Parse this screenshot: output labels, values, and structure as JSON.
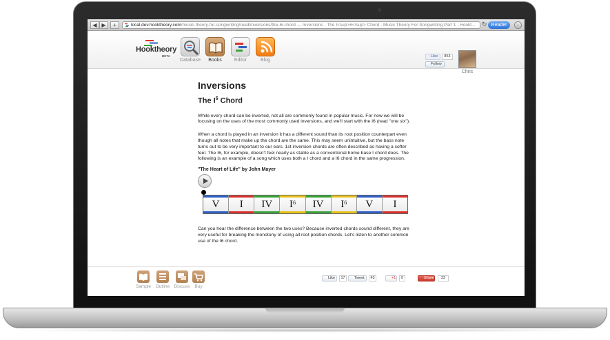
{
  "browser": {
    "url_host": "local.dev.hooktheory.com",
    "url_rest": "/music-theory-for-songwriting/read/inversions/the-i6-chord — Inversions - The I<sup>6</sup> Chord - Music Theory For Songwriting Part 1 - Hookt...",
    "reader_label": "Reader",
    "back_glyph": "◀",
    "forward_glyph": "▶",
    "new_tab_glyph": "+",
    "reload_glyph": "↻",
    "download_glyph": "↓"
  },
  "header": {
    "logo_text": "Hooktheory",
    "logo_sub": "BETA",
    "nav": [
      {
        "label": "Database",
        "icon": "magnifier-icon"
      },
      {
        "label": "Books",
        "icon": "book-icon"
      },
      {
        "label": "Editor",
        "icon": "editor-icon"
      },
      {
        "label": "Blog",
        "icon": "rss-icon"
      }
    ],
    "fb_like_label": "Like",
    "fb_like_count": "853",
    "twitter_follow_label": "Follow",
    "user_name": "Chris"
  },
  "content": {
    "title": "Inversions",
    "subtitle_prefix": "The I",
    "subtitle_sup": "6",
    "subtitle_suffix": " Chord",
    "para1": "While every chord can be inverted, not all are commonly found in popular music. For now we will be focusing on the uses of the most commonly used inversions, and we'll start with the I6 (read \"one six\").",
    "para2": "When a chord is played in an inversion it has a different sound than its root position counterpart even though all notes that make up the chord are the same. This may seem unintuitive, but the bass note turns out to be very important to our ears. 1st inversion chords are often described as having a softer feel. The I6, for example, doesn't feel nearly as stable as a conventional home base I chord does. The following is an example of a song which uses both a I chord and a I6 chord in the same progression.",
    "song_title": "\"The Heart of Life\" by John Mayer",
    "para3": "Can you hear the difference between the two uses? Because inverted chords sound different, they are very useful for breaking the monotony of using all root position chords. Let's listen to another common use of the I6 chord."
  },
  "chords": [
    {
      "numeral": "V",
      "sup": "",
      "color": "#2f5fc4"
    },
    {
      "numeral": "I",
      "sup": "",
      "color": "#d9312b"
    },
    {
      "numeral": "IV",
      "sup": "",
      "color": "#3aa33a"
    },
    {
      "numeral": "I",
      "sup": "6",
      "color": "#e8c21a"
    },
    {
      "numeral": "IV",
      "sup": "",
      "color": "#3aa33a"
    },
    {
      "numeral": "I",
      "sup": "6",
      "color": "#e8c21a"
    },
    {
      "numeral": "V",
      "sup": "",
      "color": "#2f5fc4"
    },
    {
      "numeral": "I",
      "sup": "",
      "color": "#d9312b"
    }
  ],
  "footer": {
    "tools": [
      {
        "label": "Sample",
        "icon": "book-icon"
      },
      {
        "label": "Outline",
        "icon": "outline-icon"
      },
      {
        "label": "Discuss",
        "icon": "discuss-icon"
      },
      {
        "label": "Buy",
        "icon": "cart-icon"
      }
    ],
    "like_label": "Like",
    "like_count": "17",
    "tweet_label": "Tweet",
    "tweet_count": "43",
    "gplus_label": "+1",
    "gplus_count": "0",
    "share_label": "Share",
    "share_count": "23"
  }
}
